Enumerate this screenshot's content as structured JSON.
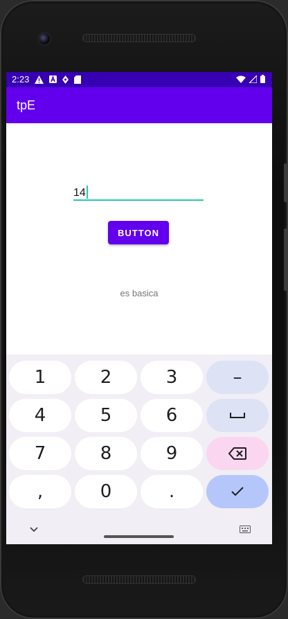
{
  "status_bar": {
    "time": "2:23",
    "icons_left": [
      "warning-icon",
      "a-icon",
      "location-icon",
      "sd-card-icon"
    ],
    "icons_right": [
      "wifi-icon",
      "signal-icon",
      "battery-icon"
    ]
  },
  "app_bar": {
    "title": "tpE"
  },
  "form": {
    "number_input_value": "14",
    "button_label": "BUTTON",
    "result_text": "es basica"
  },
  "keyboard": {
    "rows": [
      [
        "1",
        "2",
        "3",
        "–"
      ],
      [
        "4",
        "5",
        "6",
        "space-icon"
      ],
      [
        "7",
        "8",
        "9",
        "backspace-icon"
      ],
      [
        ",",
        "0",
        ".",
        "enter-check-icon"
      ]
    ],
    "nav": [
      "chevron-down-icon",
      "keyboard-icon"
    ]
  },
  "colors": {
    "status_bar": "#3700b3",
    "app_bar": "#6200ee",
    "accent": "#26c6b0",
    "keyboard_bg": "#f1eef5"
  }
}
